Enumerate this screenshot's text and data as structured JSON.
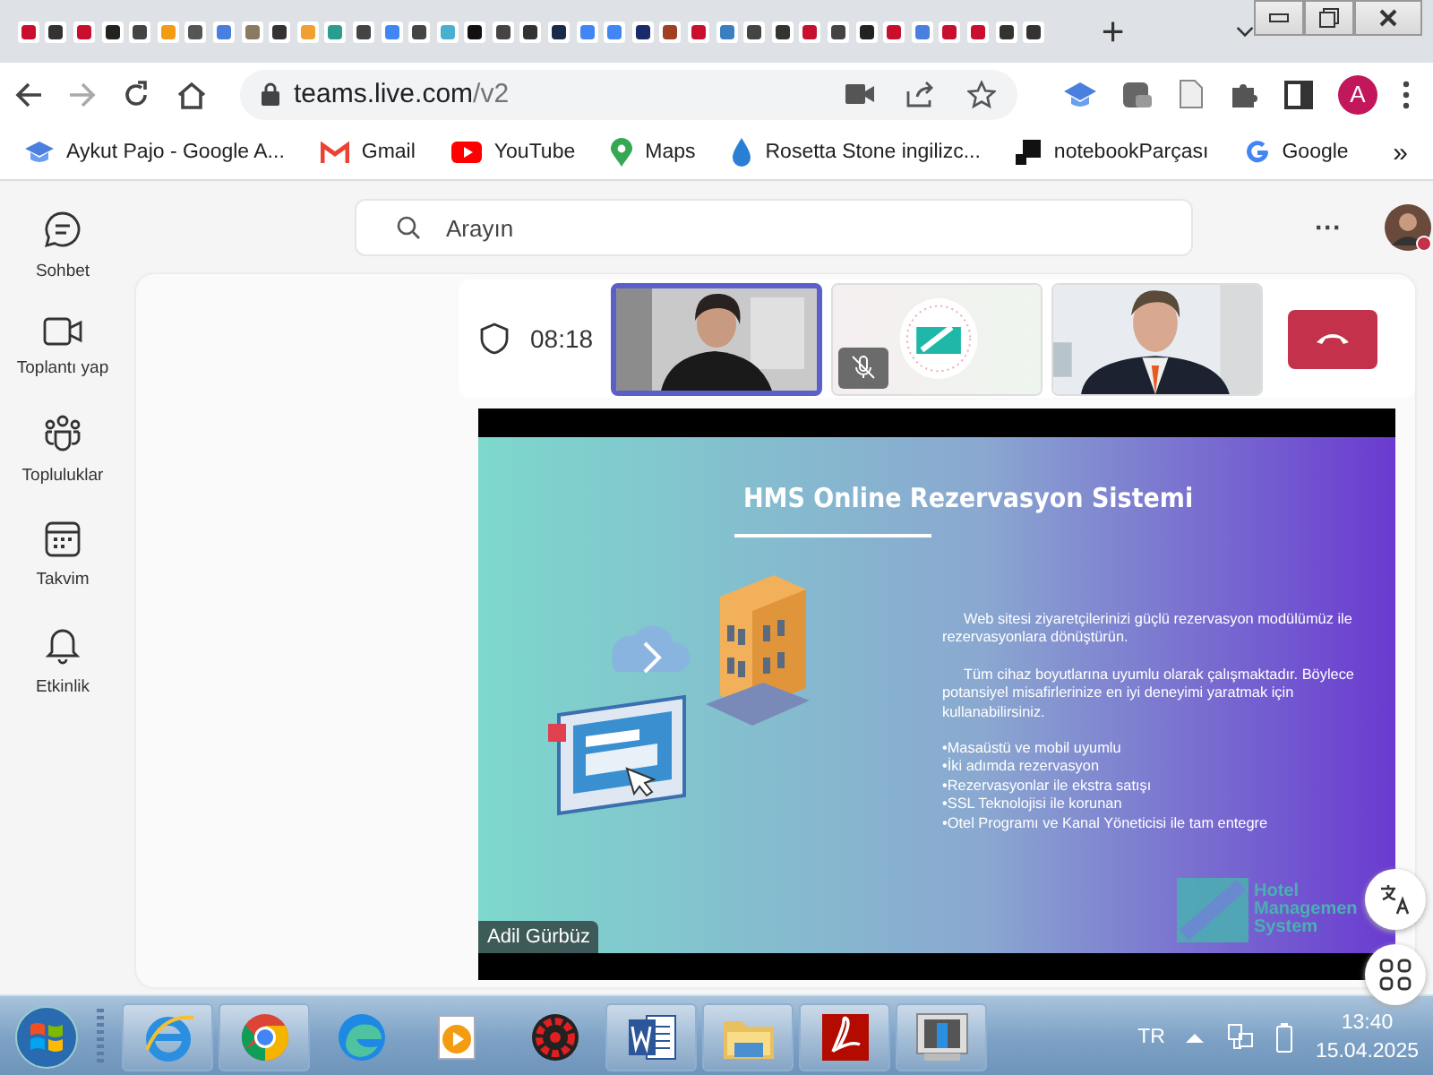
{
  "browser": {
    "new_tab": "+",
    "url_host": "teams.live.com",
    "url_path": "/v2",
    "profile_initial": "A",
    "bookmarks": [
      {
        "kind": "cap",
        "label": "Aykut Pajo - Google A..."
      },
      {
        "kind": "mail",
        "label": "Gmail"
      },
      {
        "kind": "video",
        "label": "YouTube"
      },
      {
        "kind": "pin",
        "label": "Maps"
      },
      {
        "kind": "drop",
        "label": "Rosetta Stone ingilizc..."
      },
      {
        "kind": "square",
        "label": "notebookParçası"
      },
      {
        "kind": "g",
        "label": "Google"
      }
    ],
    "more": "»"
  },
  "teams": {
    "search": {
      "placeholder": "Arayın"
    },
    "more": "···",
    "rail": [
      {
        "kind": "chat",
        "label": "Sohbet"
      },
      {
        "kind": "camera",
        "label": "Toplantı yap"
      },
      {
        "kind": "people",
        "label": "Topluluklar"
      },
      {
        "kind": "calendar",
        "label": "Takvim"
      },
      {
        "kind": "bell",
        "label": "Etkinlik"
      }
    ],
    "call": {
      "timer": "08:18",
      "tiles": [
        {
          "kind": "camera",
          "speaking": true,
          "muted": false
        },
        {
          "kind": "logo",
          "speaking": false,
          "muted": true
        },
        {
          "kind": "camera",
          "speaking": false,
          "muted": false
        }
      ]
    },
    "slide": {
      "title": "HMS Online Rezervasyon Sistemi",
      "paragraphs": [
        "Web sitesi ziyaretçilerinizi güçlü rezervasyon modülümüz ile rezervasyonlara dönüştürün.",
        "Tüm cihaz boyutlarına uyumlu olarak çalışmaktadır. Böylece potansiyel misafirlerinize en iyi deneyimi yaratmak için kullanabilirsiniz."
      ],
      "bullets": [
        "•Masaüstü ve mobil uyumlu",
        "•İki adımda rezervasyon",
        "•Rezervasyonlar ile ekstra satışı",
        "•SSL Teknolojisi ile korunan",
        "•Otel Programı ve Kanal Yöneticisi ile tam entegre"
      ],
      "logo_lines": [
        "Hotel",
        "Managemen",
        "System"
      ],
      "presenter": "Adil Gürbüz"
    }
  },
  "taskbar": {
    "apps": [
      {
        "kind": "ie",
        "running": true
      },
      {
        "kind": "chrome",
        "running": true
      },
      {
        "kind": "edge",
        "running": false
      },
      {
        "kind": "media",
        "running": false
      },
      {
        "kind": "gear",
        "running": false
      },
      {
        "kind": "word",
        "running": true
      },
      {
        "kind": "folder",
        "running": true
      },
      {
        "kind": "pdf",
        "running": true
      },
      {
        "kind": "monitor",
        "running": true
      }
    ],
    "language": "TR",
    "time": "13:40",
    "date": "15.04.2025"
  }
}
